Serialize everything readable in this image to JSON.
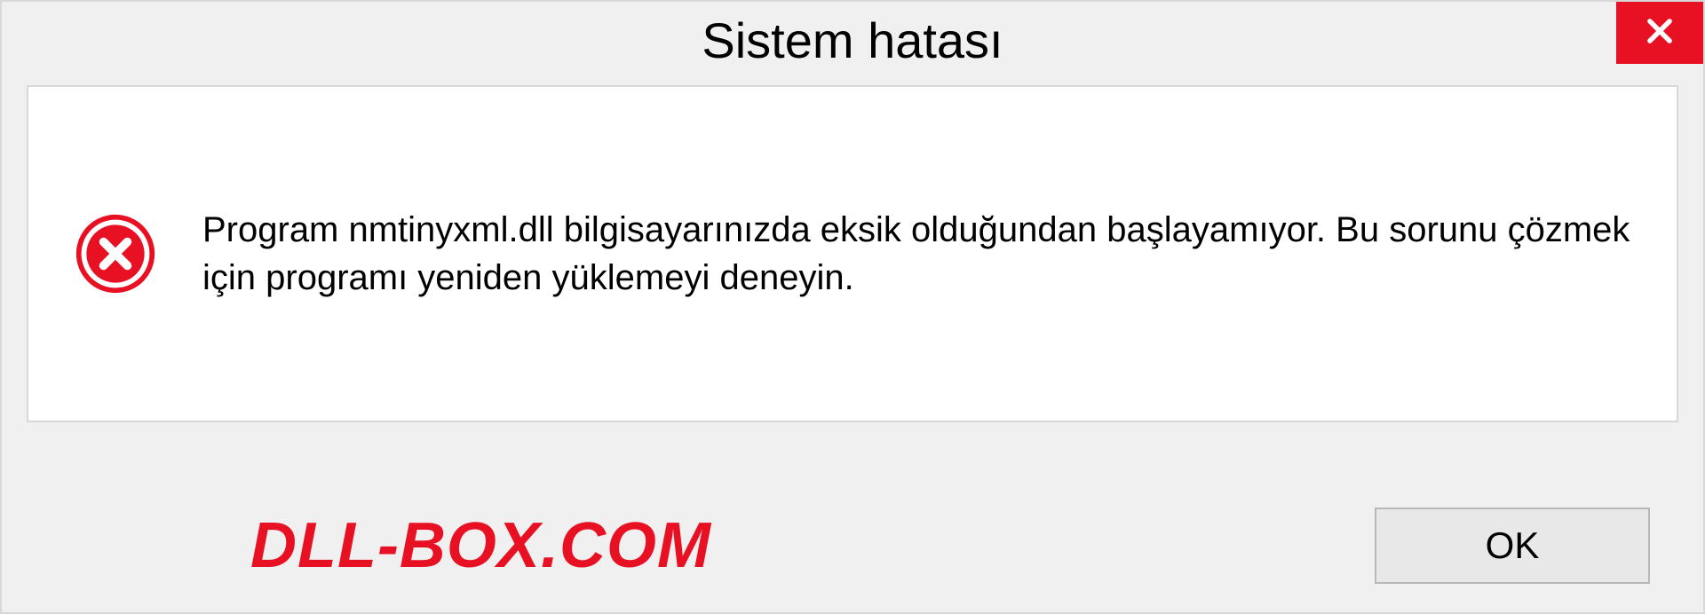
{
  "dialog": {
    "title": "Sistem hatası",
    "message": "Program nmtinyxml.dll bilgisayarınızda eksik olduğundan başlayamıyor. Bu sorunu çözmek için programı yeniden yüklemeyi deneyin.",
    "ok_label": "OK"
  },
  "watermark": "DLL-BOX.COM",
  "colors": {
    "close_bg": "#e81123",
    "error_icon": "#e81123",
    "watermark": "#e81123"
  }
}
